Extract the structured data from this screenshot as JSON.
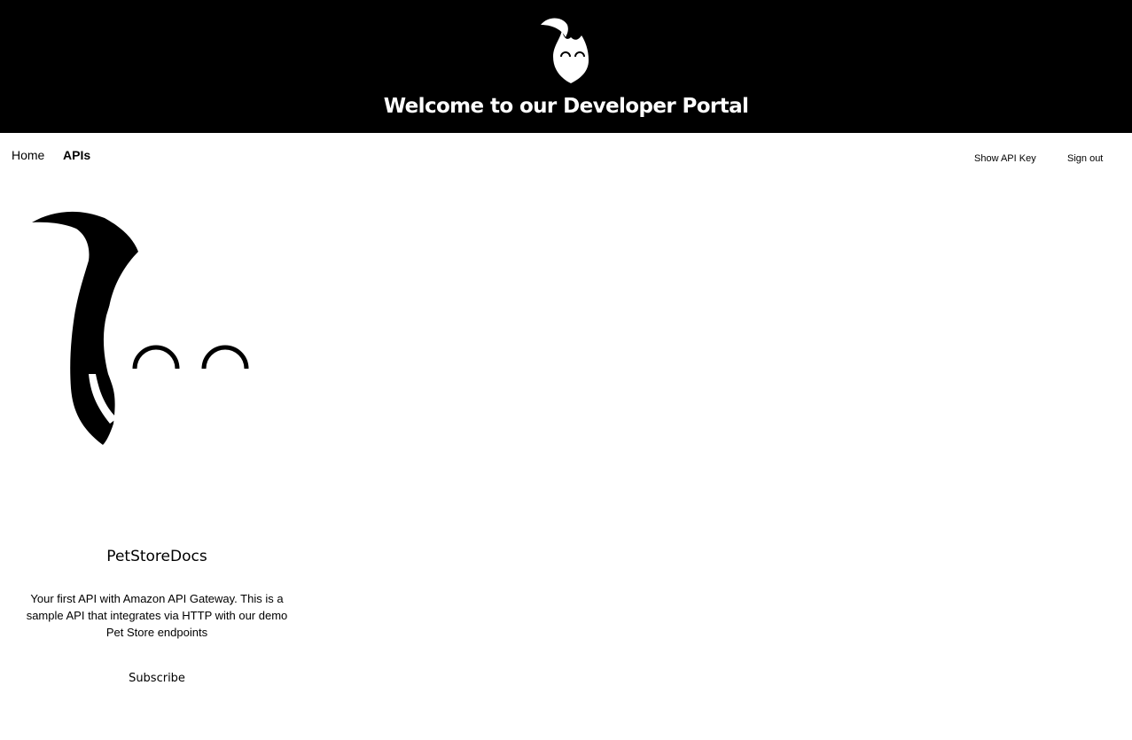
{
  "header": {
    "title": "Welcome to our Developer Portal",
    "logo_icon": "mascot-logo-icon"
  },
  "nav": {
    "home_label": "Home",
    "apis_label": "APIs",
    "show_api_key_label": "Show API Key",
    "sign_out_label": "Sign out"
  },
  "api_card": {
    "image_icon": "mascot-image-icon",
    "title": "PetStoreDocs",
    "description": "Your first API with Amazon API Gateway. This is a sample API that integrates via HTTP with our demo Pet Store endpoints",
    "subscribe_label": "Subscribe"
  },
  "colors": {
    "header_bg": "#000000",
    "header_text": "#ffffff",
    "page_bg": "#ffffff",
    "text": "#000000"
  }
}
